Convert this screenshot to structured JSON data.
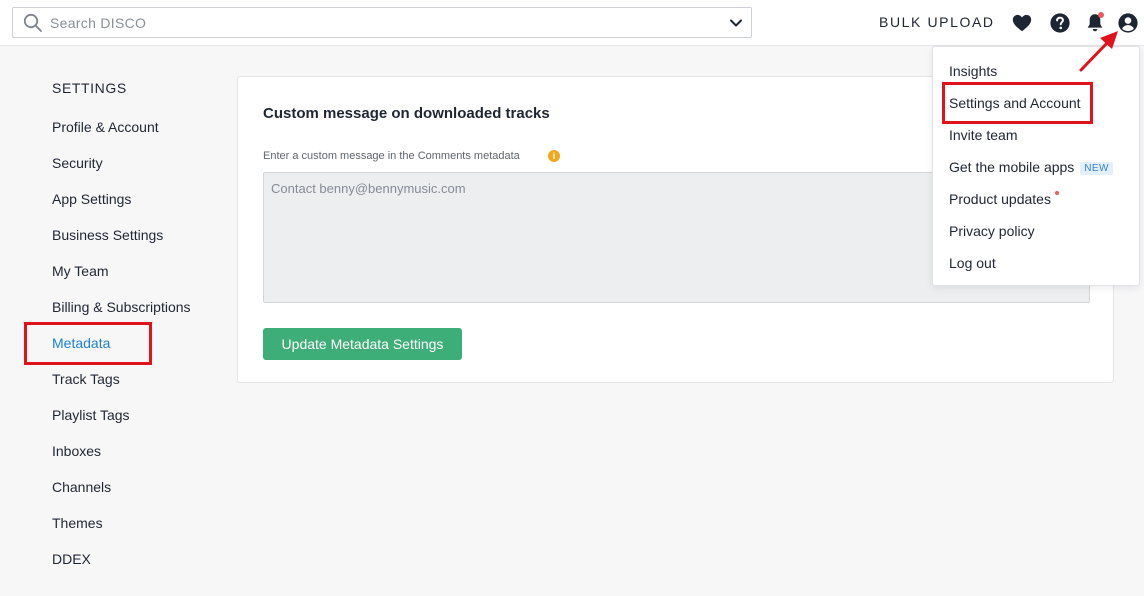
{
  "search": {
    "placeholder": "Search DISCO"
  },
  "topbar": {
    "bulk_upload": "BULK UPLOAD"
  },
  "sidebar": {
    "title": "SETTINGS",
    "items": [
      {
        "label": "Profile & Account"
      },
      {
        "label": "Security"
      },
      {
        "label": "App Settings"
      },
      {
        "label": "Business Settings"
      },
      {
        "label": "My Team"
      },
      {
        "label": "Billing & Subscriptions"
      },
      {
        "label": "Metadata",
        "active": true
      },
      {
        "label": "Track Tags"
      },
      {
        "label": "Playlist Tags"
      },
      {
        "label": "Inboxes"
      },
      {
        "label": "Channels"
      },
      {
        "label": "Themes"
      },
      {
        "label": "DDEX"
      }
    ]
  },
  "main": {
    "card_title": "Custom message on downloaded tracks",
    "field_label": "Enter a custom message in the Comments metadata",
    "message_placeholder": "Contact benny@bennymusic.com",
    "update_button": "Update Metadata Settings"
  },
  "menu": {
    "items": [
      {
        "label": "Insights"
      },
      {
        "label": "Settings and Account"
      },
      {
        "label": "Invite team"
      },
      {
        "label": "Get the mobile apps",
        "badge": "NEW"
      },
      {
        "label": "Product updates"
      },
      {
        "label": "Privacy policy"
      },
      {
        "label": "Log out"
      }
    ]
  },
  "icons": {
    "search": "search-icon",
    "chevron": "chevron-down-icon",
    "heart": "heart-icon",
    "help": "help-icon",
    "bell": "bell-icon",
    "user": "user-icon",
    "info": "info-icon"
  },
  "colors": {
    "accent_green": "#3dae77",
    "active_link": "#1f7fd0",
    "annotation_red": "#e0131d",
    "badge_blue": "#3b7fcf",
    "notification_dot": "#f25a5a",
    "info_orange": "#f2a81d"
  }
}
